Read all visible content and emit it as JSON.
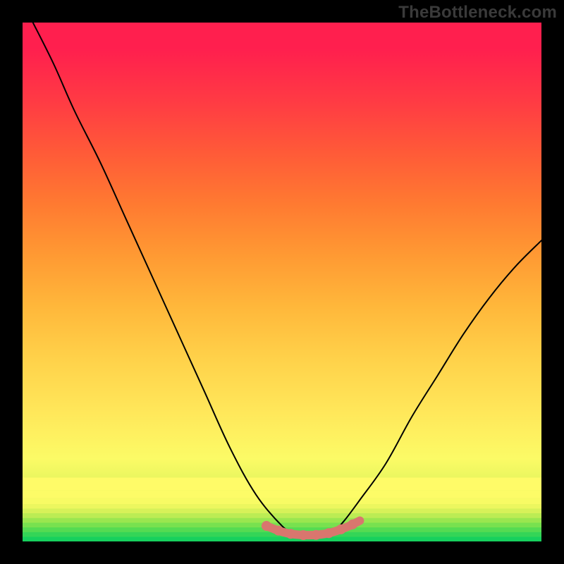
{
  "watermark": "TheBottleneck.com",
  "chart_data": {
    "type": "line",
    "title": "",
    "xlabel": "",
    "ylabel": "",
    "xlim": [
      0,
      100
    ],
    "ylim": [
      0,
      100
    ],
    "grid": false,
    "legend": false,
    "background": {
      "bands": [
        {
          "y": 0,
          "color": "#18d860"
        },
        {
          "y": 4,
          "color": "#6de04f"
        },
        {
          "y": 8,
          "color": "#b6ea56"
        },
        {
          "y": 12,
          "color": "#e9f65f"
        },
        {
          "y": 16,
          "color": "#fcfb66"
        },
        {
          "y": 25,
          "color": "#ffe75a"
        },
        {
          "y": 35,
          "color": "#ffd24a"
        },
        {
          "y": 45,
          "color": "#ffb83b"
        },
        {
          "y": 55,
          "color": "#ff9a33"
        },
        {
          "y": 65,
          "color": "#ff7a31"
        },
        {
          "y": 75,
          "color": "#ff5a38"
        },
        {
          "y": 85,
          "color": "#ff3a44"
        },
        {
          "y": 95,
          "color": "#ff1f4e"
        },
        {
          "y": 100,
          "color": "#ff1f4e"
        }
      ]
    },
    "series": [
      {
        "name": "bottleneck-curve",
        "stroke": "#000000",
        "x": [
          2,
          6,
          10,
          15,
          20,
          25,
          30,
          35,
          40,
          45,
          50,
          52,
          55,
          58,
          60,
          62,
          65,
          70,
          75,
          80,
          85,
          90,
          95,
          100
        ],
        "y": [
          100,
          92,
          83,
          73,
          62,
          51,
          40,
          29,
          18,
          9,
          3,
          2,
          1,
          1,
          2,
          4,
          8,
          15,
          24,
          32,
          40,
          47,
          53,
          58
        ]
      },
      {
        "name": "bottom-band",
        "stroke": "#d9766e",
        "thick": true,
        "x": [
          47,
          49,
          51,
          53,
          55,
          57,
          59,
          61,
          63,
          65
        ],
        "y": [
          3.0,
          2.2,
          1.6,
          1.3,
          1.2,
          1.3,
          1.6,
          2.2,
          3.0,
          4.0
        ]
      }
    ]
  }
}
